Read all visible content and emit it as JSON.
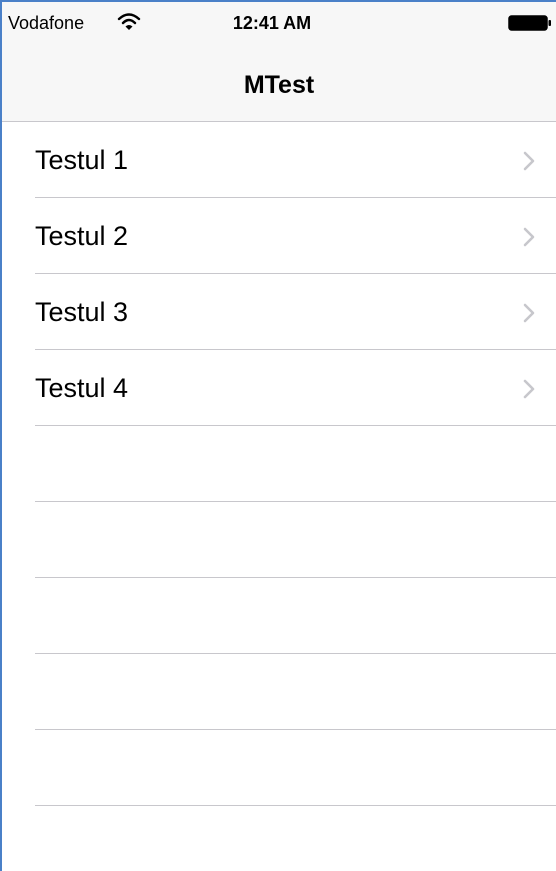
{
  "status_bar": {
    "carrier": "Vodafone",
    "time": "12:41 AM"
  },
  "nav": {
    "title": "MTest"
  },
  "list": {
    "items": [
      {
        "label": "Testul 1",
        "icon": "chevron-right-icon"
      },
      {
        "label": "Testul 2",
        "icon": "chevron-right-icon"
      },
      {
        "label": "Testul 3",
        "icon": "chevron-right-icon"
      },
      {
        "label": "Testul 4",
        "icon": "chevron-right-icon"
      }
    ]
  },
  "colors": {
    "frame_border": "#4a80c8",
    "separator": "#c8c7cc",
    "chevron": "#c7c7cc",
    "bar_background": "#f7f7f7"
  }
}
